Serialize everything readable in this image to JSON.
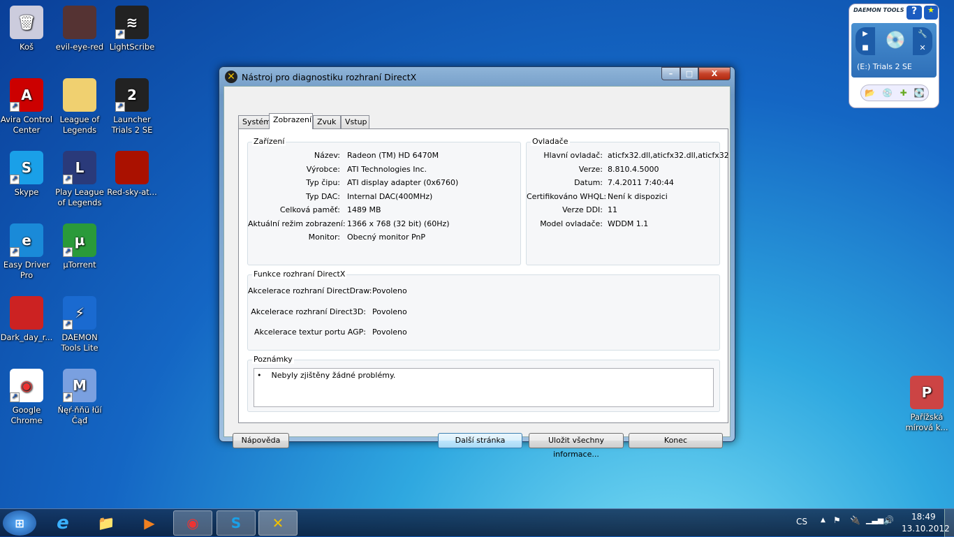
{
  "desktop_icons": [
    {
      "label": "Koš",
      "icon": "recycle-bin-icon"
    },
    {
      "label": "evil-eye-red",
      "icon": "image-icon"
    },
    {
      "label": "LightScribe",
      "icon": "lightscribe-icon"
    },
    {
      "label": "Avira Control Center",
      "icon": "avira-icon"
    },
    {
      "label": "League of Legends",
      "icon": "folder-icon"
    },
    {
      "label": "Launcher Trials 2 SE",
      "icon": "trials-icon"
    },
    {
      "label": "Skype",
      "icon": "skype-icon"
    },
    {
      "label": "Play League of Legends",
      "icon": "lol-icon"
    },
    {
      "label": "Red-sky-at...",
      "icon": "image-icon"
    },
    {
      "label": "Easy Driver Pro",
      "icon": "easy-driver-icon"
    },
    {
      "label": "µTorrent",
      "icon": "utorrent-icon"
    },
    {
      "label": "Dark_day_r...",
      "icon": "image-icon"
    },
    {
      "label": "DAEMON Tools Lite",
      "icon": "daemon-tools-icon"
    },
    {
      "label": "Google Chrome",
      "icon": "chrome-icon"
    },
    {
      "label": "Ńęŕ-ňňü łűí Čąđ",
      "icon": "app-icon"
    },
    {
      "label": "Pařížská mírová k...",
      "icon": "powerpoint-icon"
    }
  ],
  "daemon_widget": {
    "brand": "DAEMON TOOLS",
    "drive": "(E:) Trials 2 SE",
    "help": "?"
  },
  "dialog": {
    "title": "Nástroj pro diagnostiku rozhraní DirectX",
    "tabs": [
      "Systém",
      "Zobrazení",
      "Zvuk",
      "Vstup"
    ],
    "device": {
      "heading": "Zařízení",
      "rows": [
        {
          "label": "Název:",
          "value": "Radeon (TM) HD 6470M"
        },
        {
          "label": "Výrobce:",
          "value": "ATI Technologies Inc."
        },
        {
          "label": "Typ čipu:",
          "value": "ATI display adapter (0x6760)"
        },
        {
          "label": "Typ DAC:",
          "value": "Internal DAC(400MHz)"
        },
        {
          "label": "Celková paměť:",
          "value": "1489 MB"
        },
        {
          "label": "Aktuální režim zobrazení:",
          "value": "1366 x 768 (32 bit) (60Hz)"
        },
        {
          "label": "Monitor:",
          "value": "Obecný monitor PnP"
        }
      ]
    },
    "drivers": {
      "heading": "Ovladače",
      "rows": [
        {
          "label": "Hlavní ovladač:",
          "value": "aticfx32.dll,aticfx32.dll,aticfx32"
        },
        {
          "label": "Verze:",
          "value": "8.810.4.5000"
        },
        {
          "label": "Datum:",
          "value": "7.4.2011 7:40:44"
        },
        {
          "label": "Certifikováno WHQL:",
          "value": "Není k dispozici"
        },
        {
          "label": "Verze DDI:",
          "value": "11"
        },
        {
          "label": "Model ovladače:",
          "value": "WDDM 1.1"
        }
      ]
    },
    "features": {
      "heading": "Funkce rozhraní DirectX",
      "rows": [
        {
          "label": "Akcelerace rozhraní DirectDraw:",
          "value": "Povoleno"
        },
        {
          "label": "Akcelerace rozhraní Direct3D:",
          "value": "Povoleno"
        },
        {
          "label": "Akcelerace textur portu AGP:",
          "value": "Povoleno"
        }
      ]
    },
    "notes": {
      "heading": "Poznámky",
      "text": "Nebyly zjištěny žádné problémy."
    },
    "buttons": {
      "help": "Nápověda",
      "next": "Další stránka",
      "save": "Uložit všechny informace...",
      "exit": "Konec"
    }
  },
  "tray": {
    "lang": "CS",
    "time": "18:49",
    "date": "13.10.2012"
  }
}
